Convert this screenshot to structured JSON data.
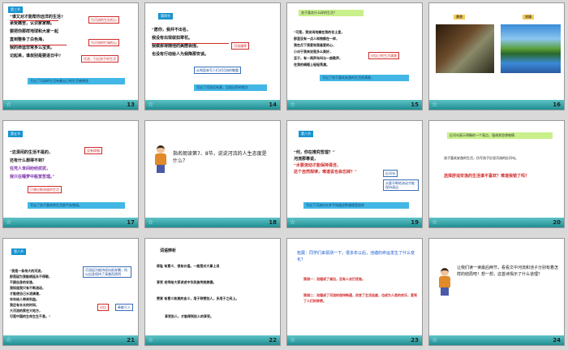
{
  "colors": {
    "tag": "#1793d0",
    "band": "#42b7e5",
    "red": "#d02a2a",
    "blue": "#2a62c0",
    "footer": "#1f8e93"
  },
  "slides": [
    {
      "num": "13",
      "tag": "第三节",
      "lines": [
        "“谁又对才能帮你远洋的生活?",
        "承受痛苦，认识家家精。",
        "要把你那样地球和大家一起",
        "直到整条了白色海，",
        "我的命运非常多么宝贵。",
        "记起来，谁叔别是要进日中?"
      ],
      "box1": "为河流的生存担心",
      "box2": "为河流的忙碌担心",
      "box3": "忧虑，引出池子的生活",
      "band": "写出了河流的生活有着自己的生活感想坐"
    },
    {
      "num": "14",
      "tag": "第四节",
      "lines": [
        "“愿你，我并不出名，",
        "我没有出现就如翠花。",
        "我做那得随他的美丽会围，",
        "也没有行动给人为我降那安谈。"
      ],
      "box1": "河流谦卑",
      "box2": "从侧面来写人们对河流的敬重",
      "band": "写出了河流没有意，比较出色的地方"
    },
    {
      "num": "15",
      "tag": "",
      "top": "池子喜欢什么样的生活？",
      "lines": [
        "“可是，我安闲地躺在我的花土里，",
        "那里没有一点人和物都在一样，",
        "我在月下我爱和我喜爱的心，",
        "小对于我来说是多么美好，",
        "至于，有一两声鸟叫与一曲歌声，",
        "在我的绸缎上轻轻荡漾。"
      ],
      "box1": "对自己的生活满意",
      "band": "写出了池子喜欢安逸的生活很满意。"
    },
    {
      "num": "16",
      "tag": "",
      "labels": [
        "黄昏",
        "池塘"
      ]
    },
    {
      "num": "17",
      "tag": "第五节",
      "lines": [
        "“这清闲的生活不是的，",
        "还有什么想得不到？",
        "任凭人世间纷纷扰扰，",
        "我只在睡梦中般宽哲理。”"
      ],
      "box1": "没有烦恼",
      "box2": "只想过那逍遥的生活",
      "band": "写出了池子喜欢的生活很平安悠闲。"
    },
    {
      "num": "18",
      "text": "指名朗读第7、8节，说说河流的人生态度是什么？"
    },
    {
      "num": "19",
      "tag": "第八节",
      "lines": [
        "“何，你在推究哲理？”",
        "河流那尊说，",
        "“水要流动才能保持清洁，",
        "这个自然规律，难道说也会忘掉？”"
      ],
      "box1": "反问句",
      "box2": "水要不断地流动才能保持清洁",
      "band": "写出了河流对水并不知道这种道理是追求"
    },
    {
      "num": "20",
      "top": "反问句表示明确的一个观点，强调其思想感情",
      "sub": "池子喜欢安逸的生活，仿写池子反驳河流的反问句。",
      "q": "选择舒适安逸的生活谁不喜欢？难道我错了吗？"
    },
    {
      "num": "21",
      "tag": "第八节",
      "lines": [
        "“我是一条伟大的河流，",
        "那是因为我能绵延永不停歇，",
        "不顾自身的安逸，",
        "我知道我只有不断流动，",
        "才能使自己水流清澈，",
        "年年给人带来利益。",
        "我还有长长的时间，",
        "大河流的家在大地方，",
        "可是中国的生命生生不息。”"
      ],
      "box1": "河流因为能持续向前奔腾，所以自身保持了清澈而透明",
      "box2": "对比",
      "box3": "奉献于人",
      "band": ""
    },
    {
      "num": "22",
      "title": "词语辨析",
      "pairs": [
        "奇耻 有意义、很有价值。一般是对大事上说",
        "享受 老师给大家讲述中华民族传统美德。",
        "赞赏 有意义和美的含义，用于称赞别人，多用于之间上。",
        "享受别人，才能得到别人的享受。"
      ]
    },
    {
      "num": "23",
      "title": "拓展：同学们来猜测一下，很多年以后，池塘的命运发生了什么变化？",
      "a1": "猜测一：池塘成了湖泊，没有人去打扰她。",
      "a2": "猜测二：池塘成了河流的保持畅通，改变了生活态度，也成为人类的欢乐，爱到了人们的称赞。"
    },
    {
      "num": "24",
      "text": "让我们读一读最后两节，看看文中河流和池子分别有着怎样的结局吧！想一想，这首诗揭示了什么道理？"
    }
  ]
}
